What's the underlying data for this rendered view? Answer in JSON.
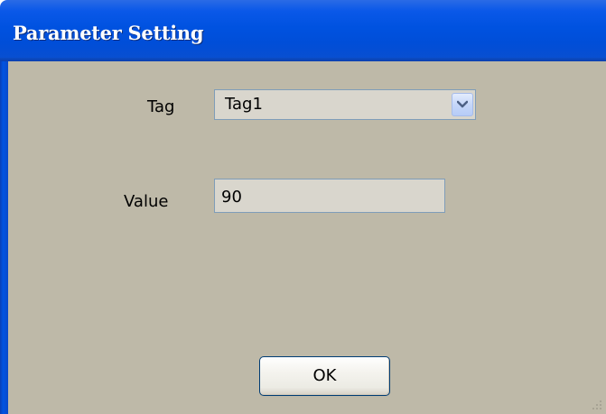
{
  "window": {
    "title": "Parameter Setting"
  },
  "form": {
    "tag_label": "Tag",
    "tag_value": "Tag1",
    "value_label": "Value",
    "value_value": "90"
  },
  "buttons": {
    "ok_label": "OK"
  },
  "colors": {
    "titlebar": "#0052e0",
    "client_background": "#beb9a8",
    "field_background": "#d9d6cd",
    "field_border": "#7f9db9"
  },
  "icons": {
    "dropdown": "chevron-down-icon",
    "resize": "resize-grip-icon"
  }
}
